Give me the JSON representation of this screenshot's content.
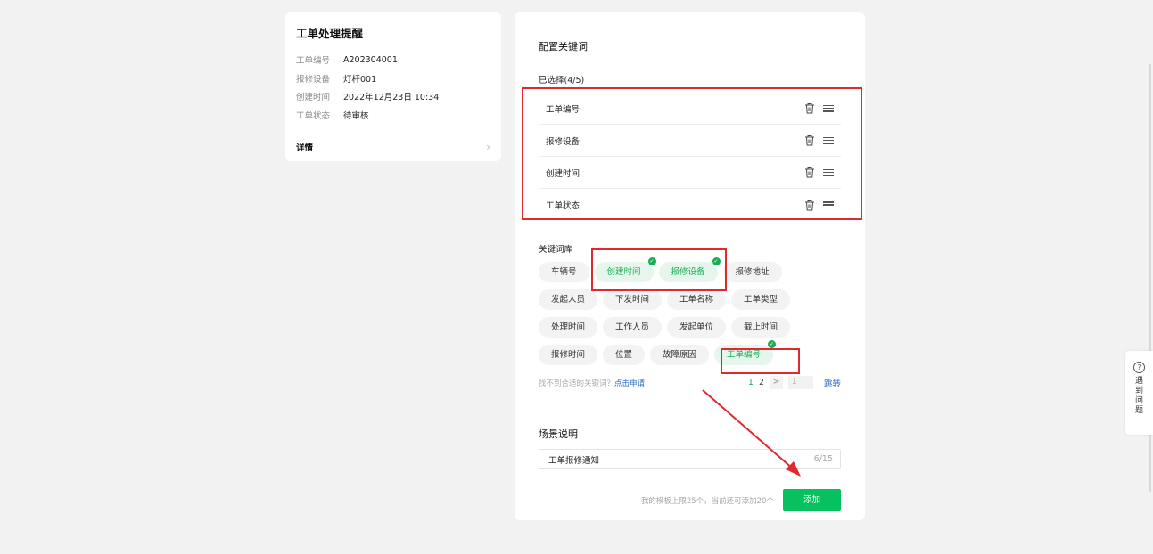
{
  "preview": {
    "title": "工单处理提醒",
    "fields": [
      {
        "key": "工单编号",
        "value": "A202304001"
      },
      {
        "key": "报修设备",
        "value": "灯杆001"
      },
      {
        "key": "创建时间",
        "value": "2022年12月23日 10:34"
      },
      {
        "key": "工单状态",
        "value": "待审核"
      }
    ],
    "detail_label": "详情"
  },
  "config": {
    "title": "配置关键词",
    "selected_label": "已选择(4/5)",
    "selected": [
      "工单编号",
      "报修设备",
      "创建时间",
      "工单状态"
    ],
    "library_label": "关键词库",
    "library": [
      [
        {
          "label": "车辆号",
          "active": false
        },
        {
          "label": "创建时间",
          "active": true
        },
        {
          "label": "报修设备",
          "active": true
        },
        {
          "label": "报修地址",
          "active": false
        }
      ],
      [
        {
          "label": "发起人员",
          "active": false
        },
        {
          "label": "下发时间",
          "active": false
        },
        {
          "label": "工单名称",
          "active": false
        },
        {
          "label": "工单类型",
          "active": false
        }
      ],
      [
        {
          "label": "处理时间",
          "active": false
        },
        {
          "label": "工作人员",
          "active": false
        },
        {
          "label": "发起单位",
          "active": false
        },
        {
          "label": "截止时间",
          "active": false
        }
      ],
      [
        {
          "label": "报修时间",
          "active": false
        },
        {
          "label": "位置",
          "active": false
        },
        {
          "label": "故障原因",
          "active": false
        },
        {
          "label": "工单编号",
          "active": true
        }
      ]
    ],
    "hint_text": "找不到合适的关键词？",
    "apply_link": "点击申请",
    "pager": {
      "page1": "1",
      "page2": "2",
      "next": ">",
      "jump_value": "1",
      "jump_label": "跳转"
    },
    "scene_label": "场景说明",
    "scene_value": "工单报修通知",
    "scene_count": "6/15",
    "limit_text": "我的模板上限25个，当前还可添加20个",
    "add_label": "添加"
  },
  "help": {
    "icon": "?",
    "label": "遇到问题"
  },
  "colors": {
    "accent": "#07c160",
    "annotation": "#e0282e",
    "link": "#2a6ebf"
  }
}
